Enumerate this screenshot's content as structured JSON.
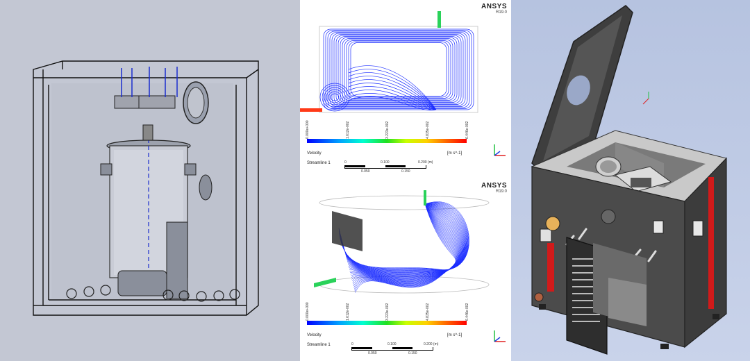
{
  "left_panel": {
    "description": ""
  },
  "top_view": {
    "logo": "ANSYS",
    "version": "R19.0",
    "legend_title": "Velocity",
    "legend_unit": "[m s^-1]",
    "legend_ticks": [
      "0.000e+000",
      "1.612e-002",
      "3.223e-002",
      "4.835e-002",
      "6.446e-002"
    ],
    "streamline_label": "Streamline 1",
    "scale_top": [
      "0",
      "0.100",
      "0.200 (m)"
    ],
    "scale_bottom": [
      "0.050",
      "0.150"
    ]
  },
  "bottom_view": {
    "logo": "ANSYS",
    "version": "R19.0",
    "legend_title": "Velocity",
    "legend_unit": "[m s^-1]",
    "legend_ticks": [
      "0.000e+000",
      "1.612e-002",
      "3.223e-002",
      "4.835e-002",
      "6.446e-002"
    ],
    "streamline_label": "Streamline 1",
    "scale_top": [
      "0",
      "0.100",
      "0.200 (m)"
    ],
    "scale_bottom": [
      "0.050",
      "0.150"
    ]
  },
  "colors": {
    "left_bg": "#c3c7d3",
    "right_bg": "#bccae6",
    "streamline": "#1a2cff",
    "cabinet": "#4a4a4a",
    "accent_red": "#d11a1a"
  }
}
